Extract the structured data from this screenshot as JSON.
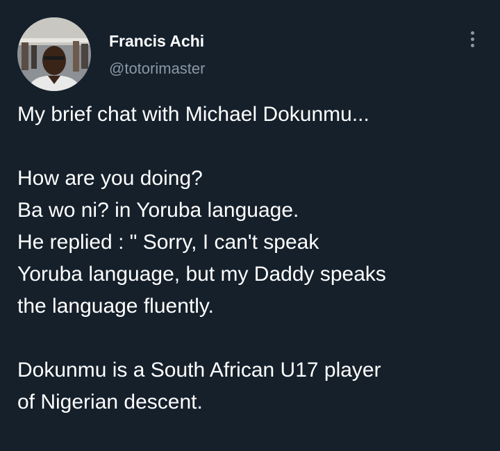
{
  "author": {
    "display_name": "Francis Achi",
    "handle": "@totorimaster",
    "avatar_icon": "profile-photo"
  },
  "menu": {
    "icon": "more-vertical-icon"
  },
  "tweet": {
    "text": "My brief chat with Michael Dokunmu...\n\nHow are you doing?\nBa wo ni? in Yoruba language.\nHe replied : \" Sorry, I can't speak\nYoruba language, but my Daddy speaks\nthe language fluently.\n\nDokunmu is a South African U17 player\nof Nigerian descent."
  },
  "colors": {
    "background": "#15202b",
    "primary_text": "#ffffff",
    "secondary_text": "#8b98a5"
  }
}
